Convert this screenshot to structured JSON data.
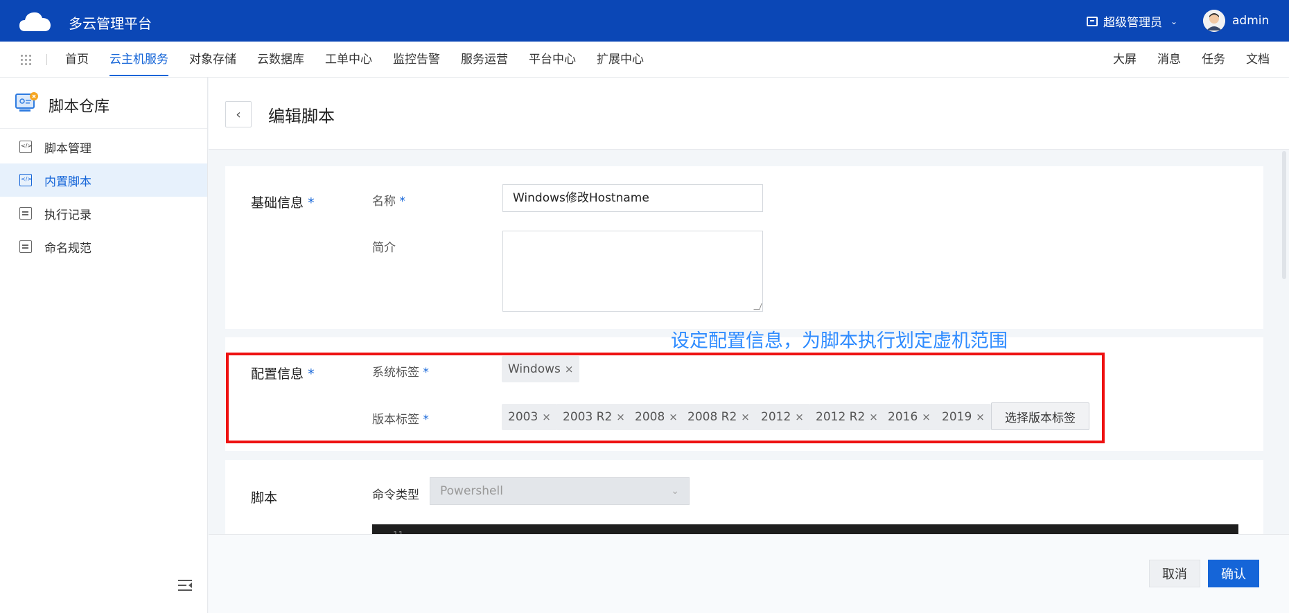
{
  "header": {
    "app_title": "多云管理平台",
    "role": "超级管理员",
    "username": "admin"
  },
  "nav": {
    "items": [
      {
        "label": "首页",
        "active": false
      },
      {
        "label": "云主机服务",
        "active": true
      },
      {
        "label": "对象存储",
        "active": false
      },
      {
        "label": "云数据库",
        "active": false
      },
      {
        "label": "工单中心",
        "active": false
      },
      {
        "label": "监控告警",
        "active": false
      },
      {
        "label": "服务运营",
        "active": false
      },
      {
        "label": "平台中心",
        "active": false
      },
      {
        "label": "扩展中心",
        "active": false
      }
    ],
    "right_items": [
      "大屏",
      "消息",
      "任务",
      "文档"
    ]
  },
  "sidebar": {
    "title": "脚本仓库",
    "items": [
      {
        "label": "脚本管理",
        "icon": "code-icon",
        "active": false
      },
      {
        "label": "内置脚本",
        "icon": "code-icon",
        "active": true
      },
      {
        "label": "执行记录",
        "icon": "document-icon",
        "active": false
      },
      {
        "label": "命名规范",
        "icon": "document-icon",
        "active": false
      }
    ]
  },
  "page": {
    "title": "编辑脚本"
  },
  "basic_info": {
    "section_label": "基础信息",
    "name_label": "名称",
    "name_value": "Windows修改Hostname",
    "desc_label": "简介",
    "desc_value": ""
  },
  "config_info": {
    "section_label": "配置信息",
    "system_tag_label": "系统标签",
    "system_tags": [
      "Windows"
    ],
    "version_tag_label": "版本标签",
    "version_tags": [
      "2003",
      "2003 R2",
      "2008",
      "2008 R2",
      "2012",
      "2012 R2",
      "2016",
      "2019"
    ],
    "select_version_button": "选择版本标签"
  },
  "annotation": "设定配置信息，为脚本执行划定虚机范围",
  "script": {
    "section_label": "脚本",
    "command_type_label": "命令类型",
    "command_type_value": "Powershell",
    "editor_line": "11"
  },
  "footer": {
    "cancel_label": "取消",
    "confirm_label": "确认"
  },
  "colors": {
    "header_bg": "#0b47b6",
    "accent": "#1565d8",
    "highlight": "#ee1111",
    "annotation": "#2e8bff"
  }
}
